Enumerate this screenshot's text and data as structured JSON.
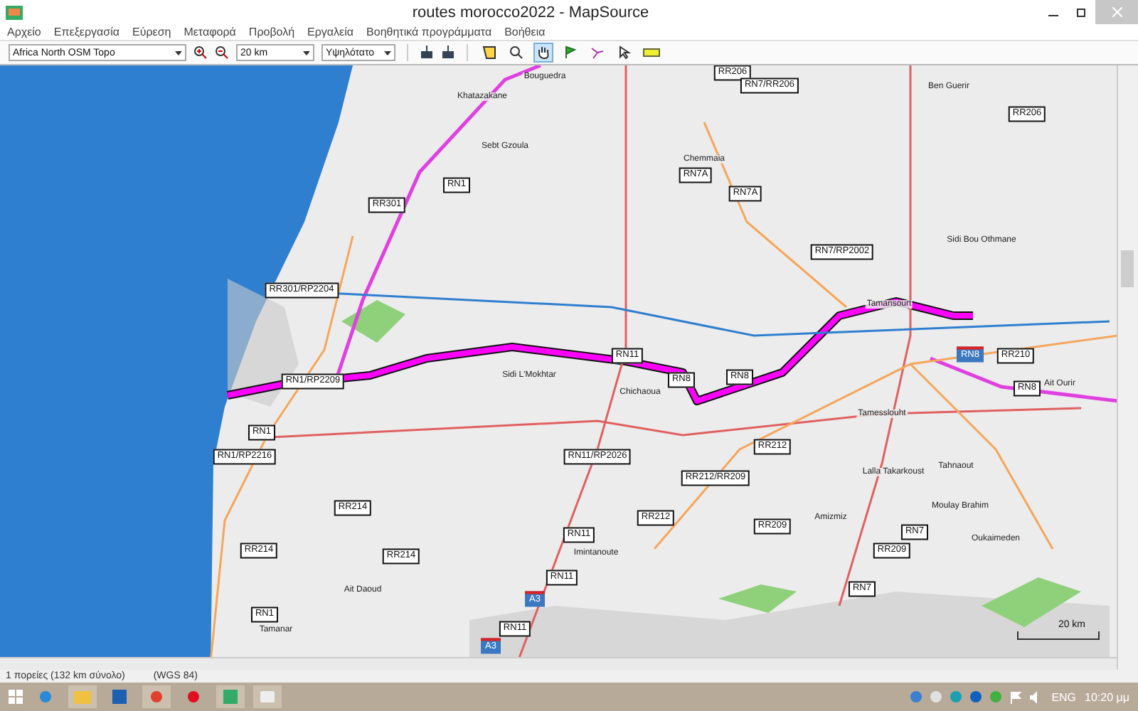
{
  "window": {
    "title": "routes morocco2022 - MapSource"
  },
  "menu": [
    "Αρχείο",
    "Επεξεργασία",
    "Εύρεση",
    "Μεταφορά",
    "Προβολή",
    "Εργαλεία",
    "Βοηθητικά προγράμματα",
    "Βοήθεια"
  ],
  "toolbar": {
    "map_product": "Africa North OSM Topo",
    "zoom": "20 km",
    "detail": "Υψηλότατο",
    "tools": [
      {
        "kind": "select-area",
        "selected": false
      },
      {
        "kind": "zoom",
        "selected": false
      },
      {
        "kind": "hand",
        "selected": true
      },
      {
        "kind": "waypoint",
        "selected": false
      },
      {
        "kind": "route",
        "selected": false
      },
      {
        "kind": "pointer",
        "selected": false
      },
      {
        "kind": "measure",
        "selected": false
      }
    ]
  },
  "map": {
    "labels": [
      {
        "kind": "place",
        "text": "Bouguedra"
      },
      {
        "kind": "road",
        "text": "RR206"
      },
      {
        "kind": "road",
        "text": "RN7/RR206"
      },
      {
        "kind": "place",
        "text": "Khatazakane"
      },
      {
        "kind": "place",
        "text": "Ben Guerir"
      },
      {
        "kind": "road",
        "text": "RR206"
      },
      {
        "kind": "place",
        "text": "Sebt Gzoula"
      },
      {
        "kind": "place",
        "text": "Chemmaia"
      },
      {
        "kind": "road",
        "text": "RN7A"
      },
      {
        "kind": "road",
        "text": "RN1"
      },
      {
        "kind": "road",
        "text": "RR301"
      },
      {
        "kind": "road",
        "text": "RN7A"
      },
      {
        "kind": "place",
        "text": "Sidi Bou Othmane"
      },
      {
        "kind": "road",
        "text": "RN7/RP2002"
      },
      {
        "kind": "road",
        "text": "RR301/RP2204"
      },
      {
        "kind": "place",
        "text": "Tamansourt"
      },
      {
        "kind": "road",
        "text": "RN11"
      },
      {
        "kind": "motorway",
        "text": "RN8"
      },
      {
        "kind": "road",
        "text": "RR210"
      },
      {
        "kind": "place",
        "text": "Sidi L'Mokhtar"
      },
      {
        "kind": "road",
        "text": "RN8"
      },
      {
        "kind": "road",
        "text": "RN8"
      },
      {
        "kind": "road",
        "text": "RN1/RP2209"
      },
      {
        "kind": "place",
        "text": "Chichaoua"
      },
      {
        "kind": "road",
        "text": "RN8"
      },
      {
        "kind": "place",
        "text": "Ait Ourir"
      },
      {
        "kind": "place",
        "text": "Tamesslouht"
      },
      {
        "kind": "road",
        "text": "RN1"
      },
      {
        "kind": "road",
        "text": "RR212"
      },
      {
        "kind": "road",
        "text": "RN1/RP2216"
      },
      {
        "kind": "road",
        "text": "RN11/RP2026"
      },
      {
        "kind": "place",
        "text": "Tahnaout"
      },
      {
        "kind": "place",
        "text": "Lalla Takarkoust"
      },
      {
        "kind": "road",
        "text": "RR212/RR209"
      },
      {
        "kind": "road",
        "text": "RR214"
      },
      {
        "kind": "place",
        "text": "Moulay Brahim"
      },
      {
        "kind": "place",
        "text": "Amizmiz"
      },
      {
        "kind": "road",
        "text": "RR212"
      },
      {
        "kind": "road",
        "text": "RR209"
      },
      {
        "kind": "road",
        "text": "RN7"
      },
      {
        "kind": "road",
        "text": "RN11"
      },
      {
        "kind": "place",
        "text": "Oukaimeden"
      },
      {
        "kind": "road",
        "text": "RR214"
      },
      {
        "kind": "road",
        "text": "RR214"
      },
      {
        "kind": "place",
        "text": "Imintanoute"
      },
      {
        "kind": "road",
        "text": "RR209"
      },
      {
        "kind": "road",
        "text": "RN11"
      },
      {
        "kind": "place",
        "text": "Ait Daoud"
      },
      {
        "kind": "road",
        "text": "RN7"
      },
      {
        "kind": "motorway",
        "text": "A3"
      },
      {
        "kind": "road",
        "text": "RN1"
      },
      {
        "kind": "place",
        "text": "Tamanar"
      },
      {
        "kind": "road",
        "text": "RN11"
      },
      {
        "kind": "motorway",
        "text": "A3"
      }
    ],
    "scale": "20 km"
  },
  "status_bar": [
    "1 πορείες (132 km σύνολο)",
    "(WGS 84)"
  ],
  "taskbar": {
    "language": "ENG",
    "time": "10:20 μμ"
  }
}
